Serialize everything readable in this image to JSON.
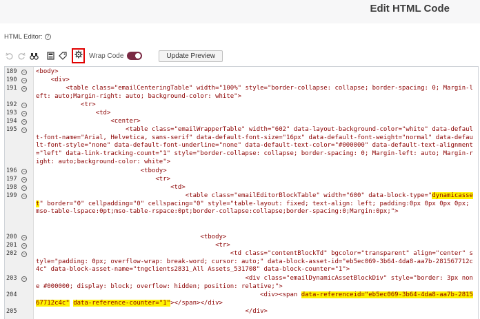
{
  "header": {
    "title": "Edit HTML Code"
  },
  "editor_label": {
    "text": "HTML Editor:",
    "info": "?"
  },
  "toolbar": {
    "undo_icon": "undo-icon",
    "redo_icon": "redo-icon",
    "find_icon": "binoculars-icon",
    "template_icon": "template-icon",
    "tag_icon": "tag-icon",
    "settings_icon": "gear-icon",
    "wrap_label": "Wrap Code",
    "wrap_enabled": true,
    "update_label": "Update Preview",
    "accent_color": "#7b2a44",
    "highlight_color": "#e00000"
  },
  "code": {
    "lines": [
      {
        "num": "189",
        "fold": "⊖",
        "parts": [
          "<body>"
        ]
      },
      {
        "num": "190",
        "fold": "⊖",
        "parts": [
          "    <div>"
        ]
      },
      {
        "num": "191",
        "fold": "⊖",
        "parts": [
          "        <table class=\"emailCenteringTable\" width=\"100%\" style=\"border-collapse: collapse; border-spacing: 0; Margin-left: auto;Margin-right: auto; background-color: white\">"
        ]
      },
      {
        "num": "192",
        "fold": "⊖",
        "parts": [
          "            <tr>"
        ]
      },
      {
        "num": "193",
        "fold": "⊖",
        "parts": [
          "                <td>"
        ]
      },
      {
        "num": "194",
        "fold": "⊖",
        "parts": [
          "                    <center>"
        ]
      },
      {
        "num": "195",
        "fold": "⊖",
        "parts": [
          "                        <table class=\"emailWrapperTable\" width=\"602\" data-layout-background-color=\"white\" data-default-font-name=\"Arial, Helvetica, sans-serif\" data-default-font-size=\"16px\" data-default-font-weight=\"normal\" data-default-font-style=\"none\" data-default-font-underline=\"none\" data-default-text-color=\"#000000\" data-default-text-alignment=\"left\" data-link-tracking-count=\"1\" style=\"border-collapse: collapse; border-spacing: 0; Margin-left: auto; Margin-right: auto;background-color: white\">"
        ]
      },
      {
        "num": "196",
        "fold": "⊖",
        "parts": [
          "                            <tbody>"
        ]
      },
      {
        "num": "197",
        "fold": "⊖",
        "parts": [
          "                                <tr>"
        ]
      },
      {
        "num": "198",
        "fold": "⊖",
        "parts": [
          "                                    <td>"
        ]
      },
      {
        "num": "199",
        "fold": "⊖",
        "parts": [
          "                                        <table class=\"emailEditorBlockTable\" width=\"600\" data-block-type=\"",
          "dynamicasset",
          "\" border=\"0\" cellpadding=\"0\" cellspacing=\"0\" style=\"table-layout: fixed; text-align: left; padding:0px 0px 0px 0px; mso-table-lspace:0pt;mso-table-rspace:0pt;border-collapse:collapse;border-spacing:0;Margin:0px;\">"
        ]
      },
      {
        "num": "200",
        "fold": "⊖",
        "parts": [
          "                                            <tbody>"
        ]
      },
      {
        "num": "201",
        "fold": "⊖",
        "parts": [
          "                                                <tr>"
        ]
      },
      {
        "num": "202",
        "fold": "⊖",
        "parts": [
          "                                                    <td class=\"contentBlockTd\" bgcolor=\"transparent\" align=\"center\" style=\"padding: 0px; overflow-wrap: break-word; cursor: auto;\" data-block-asset-id=\"eb5ec069-3b64-4da8-aa7b-281567712c4c\" data-block-asset-name=\"tngclients2831_All Assets_531708\" data-block-counter=\"1\">"
        ]
      },
      {
        "num": "203",
        "fold": "⊖",
        "parts": [
          "                                                        <div class=\"emailDynamicAssetBlockDiv\" style=\"border: 3px none #000000; display: block; overflow: hidden; position: relative;\">"
        ]
      },
      {
        "num": "204",
        "fold": "",
        "parts": [
          "                                                            <div><span ",
          "data-referenceid=\"eb5ec069-3b64-4da8-aa7b-281567712c4c\"",
          " ",
          "data-reference-counter=\"1\"",
          "></span></div>"
        ]
      },
      {
        "num": "205",
        "fold": "",
        "parts": [
          "                                                        </div>"
        ]
      }
    ]
  }
}
